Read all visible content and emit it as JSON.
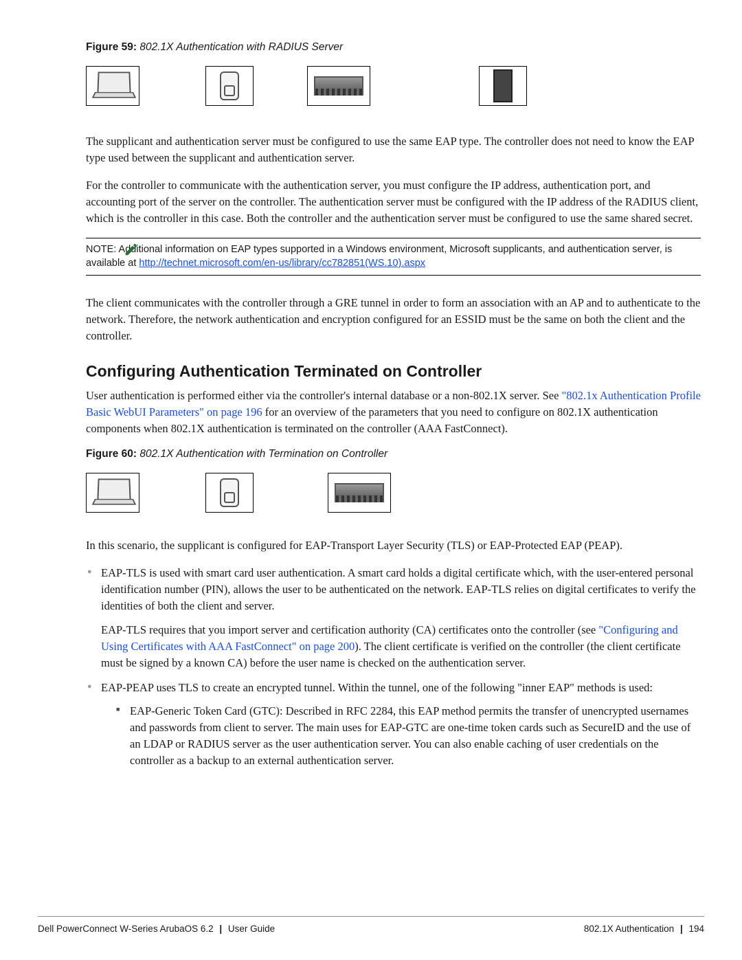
{
  "figure59": {
    "lead": "Figure 59:",
    "title": "802.1X Authentication with RADIUS Server"
  },
  "p1": "The supplicant and authentication server must be configured to use the same EAP type. The controller does not need to know the EAP type used between the supplicant and authentication server.",
  "p2": "For the controller to communicate with the authentication server, you must configure the IP address, authentication port, and accounting port of the server on the controller. The authentication server must be configured with the IP address of the RADIUS client, which is the controller in this case. Both the controller and the authentication server must be configured to use the same shared secret.",
  "note": {
    "lead": "NOTE: ",
    "text_a": "Additional information on EAP types supported in a Windows environment, Microsoft supplicants, and authentication server, is available at ",
    "link": "http://technet.microsoft.com/en-us/library/cc782851(WS.10).aspx"
  },
  "p3": "The client communicates with the controller through a GRE tunnel in order to form an association with an AP and to authenticate to the network. Therefore, the network authentication and encryption configured for an ESSID must be the same on both the client and the controller.",
  "h2": "Configuring Authentication Terminated on Controller",
  "p4_a": "User authentication is performed either via the controller's internal database or a non-802.1X server. See ",
  "link1": "\"802.1x Authentication Profile Basic WebUI Parameters\" on page 196",
  "p4_b": " for an overview of the parameters that you need to configure on 802.1X authentication components when 802.1X authentication is terminated on the controller (AAA FastConnect).",
  "figure60": {
    "lead": "Figure 60:",
    "title": "802.1X Authentication with Termination on Controller"
  },
  "p5": "In this scenario, the supplicant is configured for EAP-Transport Layer Security (TLS) or EAP-Protected EAP (PEAP).",
  "bullet1_a": "EAP-TLS is used with smart card user authentication. A smart card holds a digital certificate which, with the user-entered personal identification number (PIN), allows the user to be authenticated on the network. EAP-TLS relies on digital certificates to verify the identities of both the client and server.",
  "bullet1_b_pre": "EAP-TLS requires that you import server and certification authority (CA) certificates onto the controller (see ",
  "link2": "\"Configuring and Using Certificates with AAA FastConnect\" on page 200",
  "bullet1_b_post": "). The client certificate is verified on the controller (the client certificate must be signed by a known CA) before the user name is checked on the authentication server.",
  "bullet2": "EAP-PEAP uses TLS to create an encrypted tunnel. Within the tunnel, one of the following \"inner EAP\" methods is used:",
  "inner1": "EAP-Generic Token Card (GTC): Described in RFC 2284, this EAP method permits the transfer of unencrypted usernames and passwords from client to server. The main uses for EAP-GTC are one-time token cards such as SecureID and the use of an LDAP or RADIUS server as the user authentication server. You can also enable caching of user credentials on the controller as a backup to an external authentication server.",
  "footer": {
    "left": "Dell PowerConnect W-Series ArubaOS 6.2",
    "left2": "User Guide",
    "right1": "802.1X Authentication",
    "page": "194"
  }
}
